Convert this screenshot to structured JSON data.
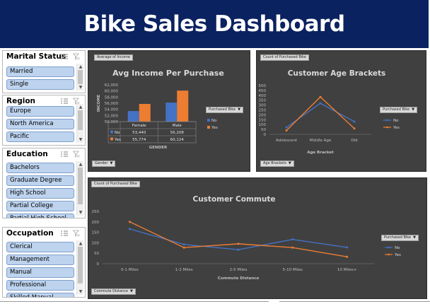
{
  "title": "Bike Sales Dashboard",
  "colors": {
    "banner": "#0b2261",
    "no": "#4472c4",
    "yes": "#ed7d31",
    "panel": "#404040",
    "slicer_item": "#bdd3ee"
  },
  "slicers": [
    {
      "title": "Marital Status",
      "items": [
        "Married",
        "Single"
      ]
    },
    {
      "title": "Region",
      "items": [
        "Europe",
        "North America",
        "Pacific"
      ]
    },
    {
      "title": "Education",
      "items": [
        "Bachelors",
        "Graduate Degree",
        "High School",
        "Partial College",
        "Partial High School"
      ]
    },
    {
      "title": "Occupation",
      "items": [
        "Clerical",
        "Management",
        "Manual",
        "Professional",
        "Skilled Manual"
      ]
    }
  ],
  "income_panel": {
    "tag": "Average of Income",
    "legend_field": "Purchased Bike",
    "axis_field": "Gender",
    "table": {
      "headers": [
        "Female",
        "Male"
      ],
      "rows": [
        {
          "label": "No",
          "values": [
            "53,440",
            "56,208"
          ]
        },
        {
          "label": "Yes",
          "values": [
            "55,774",
            "60,124"
          ]
        }
      ]
    }
  },
  "age_panel": {
    "tag": "Count of Purchased Bike",
    "legend_field": "Purchased Bike",
    "axis_field": "Age Brackets"
  },
  "commute_panel": {
    "tag": "Count of Purchased Bike",
    "legend_field": "Purchased Bike",
    "axis_field": "Commute Distance"
  },
  "chart_data": [
    {
      "type": "bar",
      "title": "Avg Income Per Purchase",
      "xlabel": "GENDER",
      "ylabel": "INCOME",
      "categories": [
        "Female",
        "Male"
      ],
      "series": [
        {
          "name": "No",
          "values": [
            53440,
            56208
          ]
        },
        {
          "name": "Yes",
          "values": [
            55774,
            60124
          ]
        }
      ],
      "ylim": [
        50000,
        62000
      ],
      "yticks": [
        "50,000",
        "52,000",
        "54,000",
        "56,000",
        "58,000",
        "60,000",
        "62,000"
      ],
      "legend": "right",
      "grid": false
    },
    {
      "type": "line",
      "title": "Customer Age Brackets",
      "xlabel": "Age Bracket",
      "ylabel": "",
      "categories": [
        "Adolescent",
        "Middle Age",
        "Old"
      ],
      "series": [
        {
          "name": "No",
          "values": [
            71,
            318,
            130
          ]
        },
        {
          "name": "Yes",
          "values": [
            39,
            383,
            60
          ]
        }
      ],
      "ylim": [
        0,
        500
      ],
      "yticks": [
        "0",
        "50",
        "100",
        "150",
        "200",
        "250",
        "300",
        "350",
        "400",
        "450",
        "500"
      ],
      "legend": "right",
      "grid": false
    },
    {
      "type": "line",
      "title": "Customer Commute",
      "xlabel": "Commute Distance",
      "ylabel": "",
      "categories": [
        "0-1 Miles",
        "1-2 Miles",
        "2-5 Miles",
        "5-10 Miles",
        "10 Miles+"
      ],
      "series": [
        {
          "name": "No",
          "values": [
            166,
            92,
            67,
            116,
            78
          ]
        },
        {
          "name": "Yes",
          "values": [
            200,
            77,
            95,
            77,
            33
          ]
        }
      ],
      "ylim": [
        0,
        250
      ],
      "yticks": [
        "0",
        "50",
        "100",
        "150",
        "200",
        "250"
      ],
      "legend": "right",
      "grid": false
    }
  ]
}
